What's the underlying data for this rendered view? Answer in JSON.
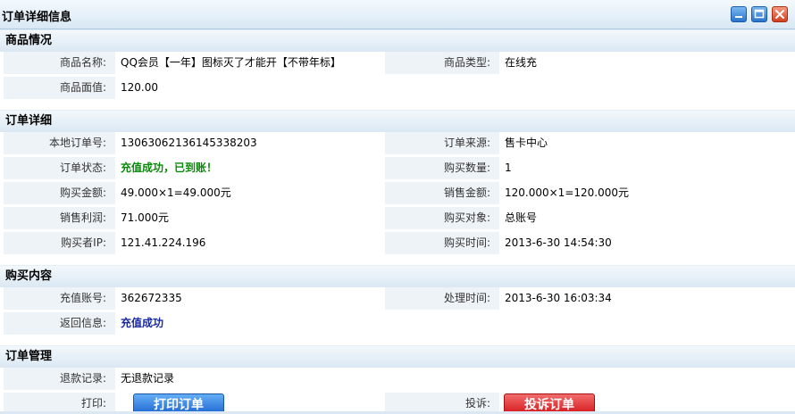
{
  "window": {
    "title": "订单详细信息"
  },
  "sections": {
    "product": {
      "header": "商品情况",
      "name_label": "商品名称:",
      "name_value": "QQ会员【一年】图标灭了才能开【不带年标】",
      "type_label": "商品类型:",
      "type_value": "在线充",
      "face_label": "商品面值:",
      "face_value": "120.00"
    },
    "order": {
      "header": "订单详细",
      "order_no_label": "本地订单号:",
      "order_no_value": "13063062136145338203",
      "source_label": "订单来源:",
      "source_value": "售卡中心",
      "status_label": "订单状态:",
      "status_value": "充值成功，已到账！",
      "qty_label": "购买数量:",
      "qty_value": "1",
      "buy_amount_label": "购买金额:",
      "buy_amount_value": "49.000×1=49.000元",
      "sale_amount_label": "销售金额:",
      "sale_amount_value": "120.000×1=120.000元",
      "profit_label": "销售利润:",
      "profit_value": "71.000元",
      "target_label": "购买对象:",
      "target_value": "总账号",
      "ip_label": "购买者IP:",
      "ip_value": "121.41.224.196",
      "time_label": "购买时间:",
      "time_value": "2013-6-30 14:54:30"
    },
    "content": {
      "header": "购买内容",
      "account_label": "充值账号:",
      "account_value": "362672335",
      "process_label": "处理时间:",
      "process_value": "2013-6-30 16:03:34",
      "return_label": "返回信息:",
      "return_value": "充值成功"
    },
    "manage": {
      "header": "订单管理",
      "refund_label": "退款记录:",
      "refund_value": "无退款记录",
      "print_label": "打印:",
      "print_button": "打印订单",
      "complaint_label": "投诉:",
      "complaint_button": "投诉订单"
    }
  },
  "colors": {
    "status_success": "#0a8a0a",
    "return_info": "#1a2aa0",
    "print_button": "#1e66d0",
    "complaint_button": "#d4161a"
  },
  "icons": [
    "minimize-icon",
    "maximize-icon",
    "close-icon"
  ]
}
